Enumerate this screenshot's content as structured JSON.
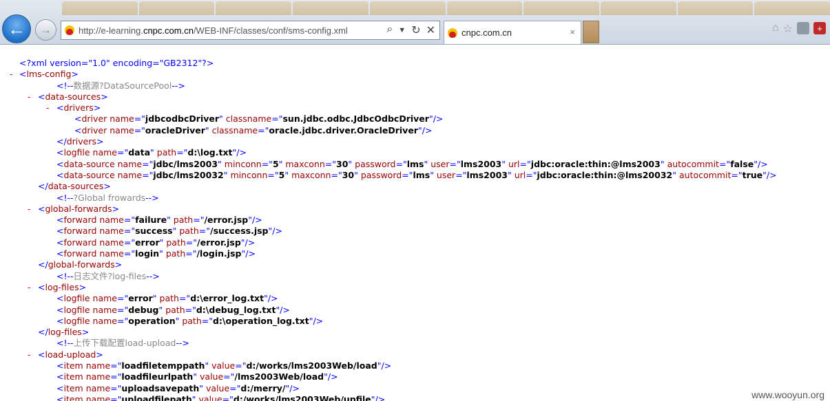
{
  "browser": {
    "url_prefix": "http://e-learning.",
    "url_host": "cnpc.com.cn",
    "url_path": "/WEB-INF/classes/conf/sms-config.xml",
    "tab_title": "cnpc.com.cn",
    "tab_close": "×",
    "back_icon": "←",
    "forward_icon": "→"
  },
  "xml_lines": [
    {
      "indent": 28,
      "segs": [
        [
          "b",
          "<?xml version=\"1.0\" encoding=\"GB2312\"?>"
        ]
      ]
    },
    {
      "indent": 28,
      "minus": 14,
      "segs": [
        [
          "b",
          "<"
        ],
        [
          "m",
          "lms-config"
        ],
        [
          "b",
          ">"
        ]
      ]
    },
    {
      "indent": 82,
      "segs": [
        [
          "b",
          "<!--"
        ],
        [
          "cm",
          "数据源?DataSourcePool"
        ],
        [
          "b",
          "-->"
        ]
      ]
    },
    {
      "indent": 55,
      "minus": 40,
      "segs": [
        [
          "b",
          "<"
        ],
        [
          "m",
          "data-sources"
        ],
        [
          "b",
          ">"
        ]
      ]
    },
    {
      "indent": 82,
      "minus": 67,
      "segs": [
        [
          "b",
          "<"
        ],
        [
          "m",
          "drivers"
        ],
        [
          "b",
          ">"
        ]
      ]
    },
    {
      "indent": 108,
      "segs": [
        [
          "b",
          "<"
        ],
        [
          "m",
          "driver name"
        ],
        [
          "b",
          "=\""
        ],
        [
          "k",
          "jdbcodbcDriver"
        ],
        [
          "b",
          "\" "
        ],
        [
          "m",
          "classname"
        ],
        [
          "b",
          "=\""
        ],
        [
          "k",
          "sun.jdbc.odbc.JdbcOdbcDriver"
        ],
        [
          "b",
          "\"/>"
        ]
      ]
    },
    {
      "indent": 108,
      "segs": [
        [
          "b",
          "<"
        ],
        [
          "m",
          "driver name"
        ],
        [
          "b",
          "=\""
        ],
        [
          "k",
          "oracleDriver"
        ],
        [
          "b",
          "\" "
        ],
        [
          "m",
          "classname"
        ],
        [
          "b",
          "=\""
        ],
        [
          "k",
          "oracle.jdbc.driver.OracleDriver"
        ],
        [
          "b",
          "\"/>"
        ]
      ]
    },
    {
      "indent": 82,
      "segs": [
        [
          "b",
          "</"
        ],
        [
          "m",
          "drivers"
        ],
        [
          "b",
          ">"
        ]
      ]
    },
    {
      "indent": 82,
      "segs": [
        [
          "b",
          "<"
        ],
        [
          "m",
          "logfile name"
        ],
        [
          "b",
          "=\""
        ],
        [
          "k",
          "data"
        ],
        [
          "b",
          "\" "
        ],
        [
          "m",
          "path"
        ],
        [
          "b",
          "=\""
        ],
        [
          "k",
          "d:\\log.txt"
        ],
        [
          "b",
          "\"/>"
        ]
      ]
    },
    {
      "indent": 82,
      "segs": [
        [
          "b",
          "<"
        ],
        [
          "m",
          "data-source name"
        ],
        [
          "b",
          "=\""
        ],
        [
          "k",
          "jdbc/lms2003"
        ],
        [
          "b",
          "\" "
        ],
        [
          "m",
          "minconn"
        ],
        [
          "b",
          "=\""
        ],
        [
          "k",
          "5"
        ],
        [
          "b",
          "\" "
        ],
        [
          "m",
          "maxconn"
        ],
        [
          "b",
          "=\""
        ],
        [
          "k",
          "30"
        ],
        [
          "b",
          "\" "
        ],
        [
          "m",
          "password"
        ],
        [
          "b",
          "=\""
        ],
        [
          "k",
          "lms"
        ],
        [
          "b",
          "\" "
        ],
        [
          "m",
          "user"
        ],
        [
          "b",
          "=\""
        ],
        [
          "k",
          "lms2003"
        ],
        [
          "b",
          "\" "
        ],
        [
          "m",
          "url"
        ],
        [
          "b",
          "=\""
        ],
        [
          "k",
          "jdbc:oracle:thin:@lms2003"
        ],
        [
          "b",
          "\" "
        ],
        [
          "m",
          "autocommit"
        ],
        [
          "b",
          "=\""
        ],
        [
          "k",
          "false"
        ],
        [
          "b",
          "\"/>"
        ]
      ]
    },
    {
      "indent": 82,
      "segs": [
        [
          "b",
          "<"
        ],
        [
          "m",
          "data-source name"
        ],
        [
          "b",
          "=\""
        ],
        [
          "k",
          "jdbc/lms20032"
        ],
        [
          "b",
          "\" "
        ],
        [
          "m",
          "minconn"
        ],
        [
          "b",
          "=\""
        ],
        [
          "k",
          "5"
        ],
        [
          "b",
          "\" "
        ],
        [
          "m",
          "maxconn"
        ],
        [
          "b",
          "=\""
        ],
        [
          "k",
          "30"
        ],
        [
          "b",
          "\" "
        ],
        [
          "m",
          "password"
        ],
        [
          "b",
          "=\""
        ],
        [
          "k",
          "lms"
        ],
        [
          "b",
          "\" "
        ],
        [
          "m",
          "user"
        ],
        [
          "b",
          "=\""
        ],
        [
          "k",
          "lms2003"
        ],
        [
          "b",
          "\" "
        ],
        [
          "m",
          "url"
        ],
        [
          "b",
          "=\""
        ],
        [
          "k",
          "jdbc:oracle:thin:@lms20032"
        ],
        [
          "b",
          "\" "
        ],
        [
          "m",
          "autocommit"
        ],
        [
          "b",
          "=\""
        ],
        [
          "k",
          "true"
        ],
        [
          "b",
          "\"/>"
        ]
      ]
    },
    {
      "indent": 55,
      "segs": [
        [
          "b",
          "</"
        ],
        [
          "m",
          "data-sources"
        ],
        [
          "b",
          ">"
        ]
      ]
    },
    {
      "indent": 82,
      "segs": [
        [
          "b",
          "<!--"
        ],
        [
          "cm",
          "?Global frowards"
        ],
        [
          "b",
          "-->"
        ]
      ]
    },
    {
      "indent": 55,
      "minus": 40,
      "segs": [
        [
          "b",
          "<"
        ],
        [
          "m",
          "global-forwards"
        ],
        [
          "b",
          ">"
        ]
      ]
    },
    {
      "indent": 82,
      "segs": [
        [
          "b",
          "<"
        ],
        [
          "m",
          "forward name"
        ],
        [
          "b",
          "=\""
        ],
        [
          "k",
          "failure"
        ],
        [
          "b",
          "\" "
        ],
        [
          "m",
          "path"
        ],
        [
          "b",
          "=\""
        ],
        [
          "k",
          "/error.jsp"
        ],
        [
          "b",
          "\"/>"
        ]
      ]
    },
    {
      "indent": 82,
      "segs": [
        [
          "b",
          "<"
        ],
        [
          "m",
          "forward name"
        ],
        [
          "b",
          "=\""
        ],
        [
          "k",
          "success"
        ],
        [
          "b",
          "\" "
        ],
        [
          "m",
          "path"
        ],
        [
          "b",
          "=\""
        ],
        [
          "k",
          "/success.jsp"
        ],
        [
          "b",
          "\"/>"
        ]
      ]
    },
    {
      "indent": 82,
      "segs": [
        [
          "b",
          "<"
        ],
        [
          "m",
          "forward name"
        ],
        [
          "b",
          "=\""
        ],
        [
          "k",
          "error"
        ],
        [
          "b",
          "\" "
        ],
        [
          "m",
          "path"
        ],
        [
          "b",
          "=\""
        ],
        [
          "k",
          "/error.jsp"
        ],
        [
          "b",
          "\"/>"
        ]
      ]
    },
    {
      "indent": 82,
      "segs": [
        [
          "b",
          "<"
        ],
        [
          "m",
          "forward name"
        ],
        [
          "b",
          "=\""
        ],
        [
          "k",
          "login"
        ],
        [
          "b",
          "\" "
        ],
        [
          "m",
          "path"
        ],
        [
          "b",
          "=\""
        ],
        [
          "k",
          "/login.jsp"
        ],
        [
          "b",
          "\"/>"
        ]
      ]
    },
    {
      "indent": 55,
      "segs": [
        [
          "b",
          "</"
        ],
        [
          "m",
          "global-forwards"
        ],
        [
          "b",
          ">"
        ]
      ]
    },
    {
      "indent": 82,
      "segs": [
        [
          "b",
          "<!--"
        ],
        [
          "cm",
          "日志文件?log-files"
        ],
        [
          "b",
          "-->"
        ]
      ]
    },
    {
      "indent": 55,
      "minus": 40,
      "segs": [
        [
          "b",
          "<"
        ],
        [
          "m",
          "log-files"
        ],
        [
          "b",
          ">"
        ]
      ]
    },
    {
      "indent": 82,
      "segs": [
        [
          "b",
          "<"
        ],
        [
          "m",
          "logfile name"
        ],
        [
          "b",
          "=\""
        ],
        [
          "k",
          "error"
        ],
        [
          "b",
          "\" "
        ],
        [
          "m",
          "path"
        ],
        [
          "b",
          "=\""
        ],
        [
          "k",
          "d:\\error_log.txt"
        ],
        [
          "b",
          "\"/>"
        ]
      ]
    },
    {
      "indent": 82,
      "segs": [
        [
          "b",
          "<"
        ],
        [
          "m",
          "logfile name"
        ],
        [
          "b",
          "=\""
        ],
        [
          "k",
          "debug"
        ],
        [
          "b",
          "\" "
        ],
        [
          "m",
          "path"
        ],
        [
          "b",
          "=\""
        ],
        [
          "k",
          "d:\\debug_log.txt"
        ],
        [
          "b",
          "\"/>"
        ]
      ]
    },
    {
      "indent": 82,
      "segs": [
        [
          "b",
          "<"
        ],
        [
          "m",
          "logfile name"
        ],
        [
          "b",
          "=\""
        ],
        [
          "k",
          "operation"
        ],
        [
          "b",
          "\" "
        ],
        [
          "m",
          "path"
        ],
        [
          "b",
          "=\""
        ],
        [
          "k",
          "d:\\operation_log.txt"
        ],
        [
          "b",
          "\"/>"
        ]
      ]
    },
    {
      "indent": 55,
      "segs": [
        [
          "b",
          "</"
        ],
        [
          "m",
          "log-files"
        ],
        [
          "b",
          ">"
        ]
      ]
    },
    {
      "indent": 82,
      "segs": [
        [
          "b",
          "<!--"
        ],
        [
          "cm",
          "上传下载配置load-upload"
        ],
        [
          "b",
          "-->"
        ]
      ]
    },
    {
      "indent": 55,
      "minus": 40,
      "segs": [
        [
          "b",
          "<"
        ],
        [
          "m",
          "load-upload"
        ],
        [
          "b",
          ">"
        ]
      ]
    },
    {
      "indent": 82,
      "segs": [
        [
          "b",
          "<"
        ],
        [
          "m",
          "item name"
        ],
        [
          "b",
          "=\""
        ],
        [
          "k",
          "loadfiletemppath"
        ],
        [
          "b",
          "\" "
        ],
        [
          "m",
          "value"
        ],
        [
          "b",
          "=\""
        ],
        [
          "k",
          "d:/works/lms2003Web/load"
        ],
        [
          "b",
          "\"/>"
        ]
      ]
    },
    {
      "indent": 82,
      "segs": [
        [
          "b",
          "<"
        ],
        [
          "m",
          "item name"
        ],
        [
          "b",
          "=\""
        ],
        [
          "k",
          "loadfileurlpath"
        ],
        [
          "b",
          "\" "
        ],
        [
          "m",
          "value"
        ],
        [
          "b",
          "=\""
        ],
        [
          "k",
          "/lms2003Web/load"
        ],
        [
          "b",
          "\"/>"
        ]
      ]
    },
    {
      "indent": 82,
      "segs": [
        [
          "b",
          "<"
        ],
        [
          "m",
          "item name"
        ],
        [
          "b",
          "=\""
        ],
        [
          "k",
          "uploadsavepath"
        ],
        [
          "b",
          "\" "
        ],
        [
          "m",
          "value"
        ],
        [
          "b",
          "=\""
        ],
        [
          "k",
          "d:/merry/"
        ],
        [
          "b",
          "\"/>"
        ]
      ]
    },
    {
      "indent": 82,
      "segs": [
        [
          "b",
          "<"
        ],
        [
          "m",
          "item name"
        ],
        [
          "b",
          "=\""
        ],
        [
          "k",
          "uploadfilepath"
        ],
        [
          "b",
          "\" "
        ],
        [
          "m",
          "value"
        ],
        [
          "b",
          "=\""
        ],
        [
          "k",
          "d:/works/lms2003Web/upfile"
        ],
        [
          "b",
          "\"/>"
        ]
      ]
    }
  ],
  "minus_glyph": "-",
  "watermark": "www.wooyun.org"
}
